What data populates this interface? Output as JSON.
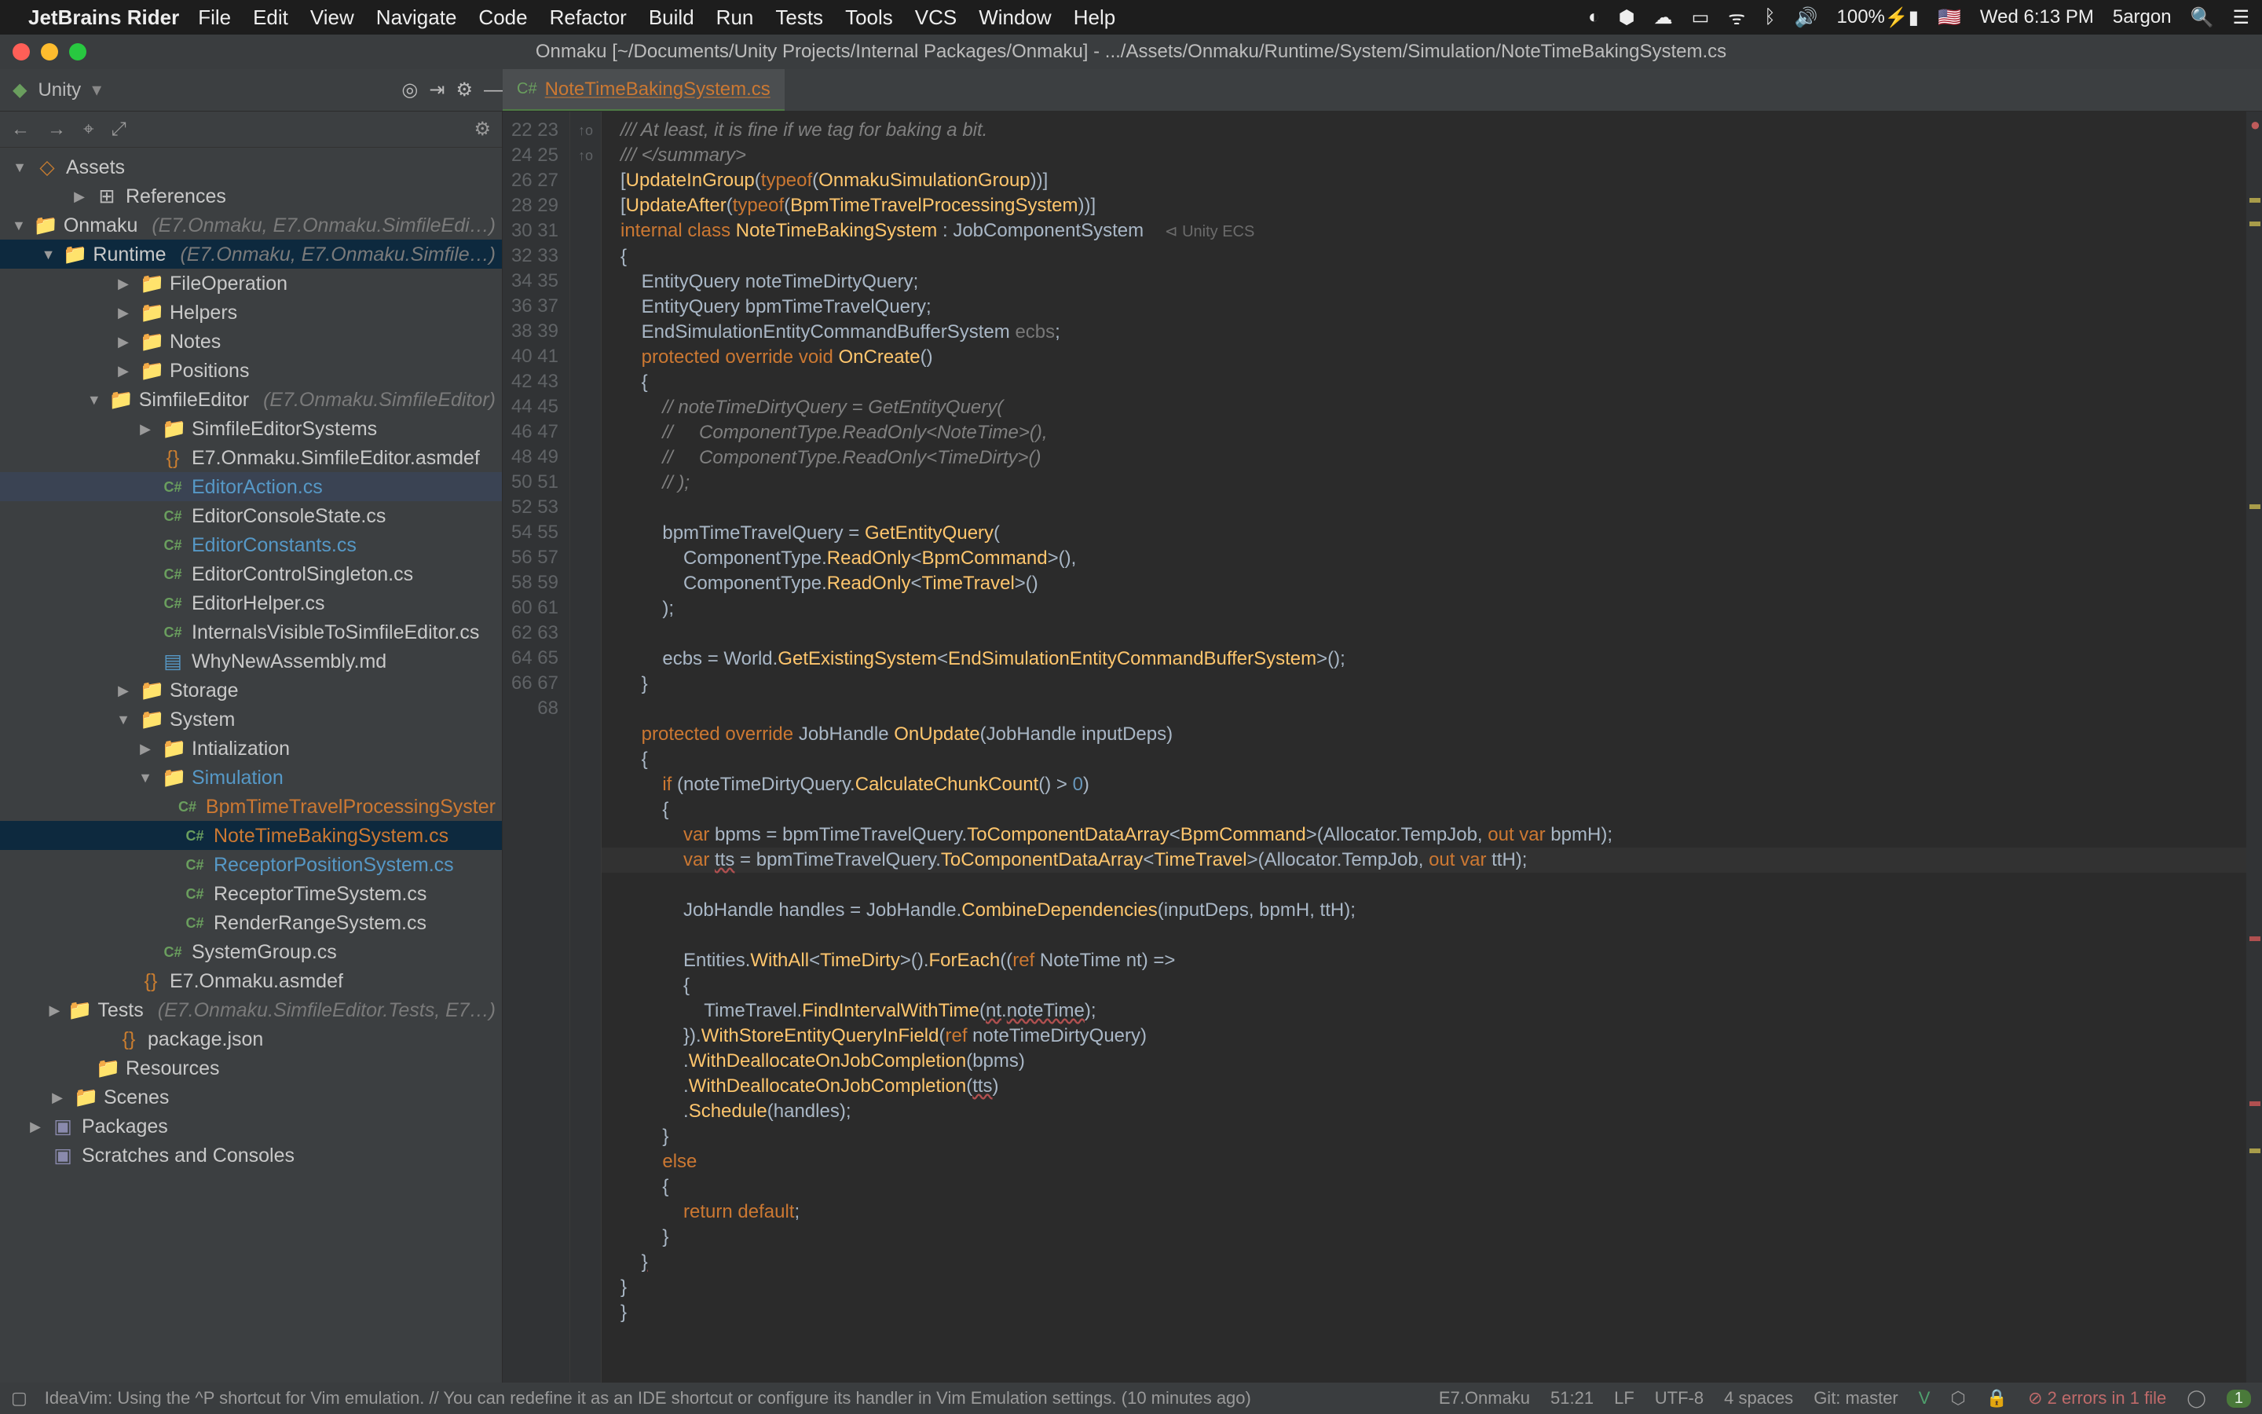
{
  "menubar": {
    "app": "JetBrains Rider",
    "items": [
      "File",
      "Edit",
      "View",
      "Navigate",
      "Code",
      "Refactor",
      "Build",
      "Run",
      "Tests",
      "Tools",
      "VCS",
      "Window",
      "Help"
    ],
    "tray": {
      "battery": "100%",
      "clock": "Wed 6:13 PM",
      "user": "5argon"
    }
  },
  "titlebar": {
    "title": "Onmaku [~/Documents/Unity Projects/Internal Packages/Onmaku] - .../Assets/Onmaku/Runtime/System/Simulation/NoteTimeBakingSystem.cs"
  },
  "topbar": {
    "crumb": "Unity",
    "tab": {
      "tag": "C#",
      "name": "NoteTimeBakingSystem.cs"
    }
  },
  "project_root_label": "Assets",
  "tree": [
    {
      "d": 0,
      "tw": "▶",
      "ic": "ref",
      "t": "References"
    },
    {
      "d": 0,
      "tw": "▼",
      "ic": "folder",
      "t": "Onmaku",
      "dim": "(E7.Onmaku, E7.Onmaku.SimfileEdi…)"
    },
    {
      "d": 1,
      "tw": "▼",
      "ic": "folder",
      "t": "Runtime",
      "dim": "(E7.Onmaku, E7.Onmaku.Simfile…)",
      "hi": true
    },
    {
      "d": 2,
      "tw": "▶",
      "ic": "folder",
      "t": "FileOperation"
    },
    {
      "d": 2,
      "tw": "▶",
      "ic": "folder",
      "t": "Helpers"
    },
    {
      "d": 2,
      "tw": "▶",
      "ic": "folder",
      "t": "Notes"
    },
    {
      "d": 2,
      "tw": "▶",
      "ic": "folder",
      "t": "Positions"
    },
    {
      "d": 2,
      "tw": "▼",
      "ic": "folder",
      "t": "SimfileEditor",
      "dim": "(E7.Onmaku.SimfileEditor)"
    },
    {
      "d": 3,
      "tw": "▶",
      "ic": "folder",
      "t": "SimfileEditorSystems"
    },
    {
      "d": 3,
      "tw": "",
      "ic": "asm",
      "t": "E7.Onmaku.SimfileEditor.asmdef"
    },
    {
      "d": 3,
      "tw": "",
      "ic": "cs",
      "t": "EditorAction.cs",
      "cls": "blue",
      "sel": true
    },
    {
      "d": 3,
      "tw": "",
      "ic": "cs",
      "t": "EditorConsoleState.cs"
    },
    {
      "d": 3,
      "tw": "",
      "ic": "cs",
      "t": "EditorConstants.cs",
      "cls": "blue"
    },
    {
      "d": 3,
      "tw": "",
      "ic": "cs",
      "t": "EditorControlSingleton.cs"
    },
    {
      "d": 3,
      "tw": "",
      "ic": "cs",
      "t": "EditorHelper.cs"
    },
    {
      "d": 3,
      "tw": "",
      "ic": "cs",
      "t": "InternalsVisibleToSimfileEditor.cs"
    },
    {
      "d": 3,
      "tw": "",
      "ic": "md",
      "t": "WhyNewAssembly.md"
    },
    {
      "d": 2,
      "tw": "▶",
      "ic": "folder",
      "t": "Storage"
    },
    {
      "d": 2,
      "tw": "▼",
      "ic": "folder",
      "t": "System"
    },
    {
      "d": 3,
      "tw": "▶",
      "ic": "folder",
      "t": "Intialization"
    },
    {
      "d": 3,
      "tw": "▼",
      "ic": "folder",
      "t": "Simulation",
      "cls": "blue"
    },
    {
      "d": 4,
      "tw": "",
      "ic": "cs",
      "t": "BpmTimeTravelProcessingSyster",
      "cls": "orange"
    },
    {
      "d": 4,
      "tw": "",
      "ic": "cs",
      "t": "NoteTimeBakingSystem.cs",
      "cls": "orange",
      "hi": true
    },
    {
      "d": 4,
      "tw": "",
      "ic": "cs",
      "t": "ReceptorPositionSystem.cs",
      "cls": "blue"
    },
    {
      "d": 4,
      "tw": "",
      "ic": "cs",
      "t": "ReceptorTimeSystem.cs"
    },
    {
      "d": 4,
      "tw": "",
      "ic": "cs",
      "t": "RenderRangeSystem.cs"
    },
    {
      "d": 3,
      "tw": "",
      "ic": "cs",
      "t": "SystemGroup.cs"
    },
    {
      "d": 2,
      "tw": "",
      "ic": "asm",
      "t": "E7.Onmaku.asmdef"
    },
    {
      "d": 1,
      "tw": "▶",
      "ic": "folder",
      "t": "Tests",
      "dim": "(E7.Onmaku.SimfileEditor.Tests, E7…)"
    },
    {
      "d": 1,
      "tw": "",
      "ic": "json",
      "t": "package.json"
    },
    {
      "d": 0,
      "tw": "",
      "ic": "folder",
      "t": "Resources"
    },
    {
      "d": -1,
      "tw": "▶",
      "ic": "folder",
      "t": "Scenes"
    },
    {
      "d": -2,
      "tw": "▶",
      "ic": "pkg",
      "t": "Packages"
    },
    {
      "d": -2,
      "tw": "",
      "ic": "pkg",
      "t": "Scratches and Consoles"
    }
  ],
  "gutter_start": 22,
  "gutter_end": 68,
  "code_hint_line26": "⊲ Unity ECS",
  "status": {
    "msg": "IdeaVim: Using the ^P shortcut for Vim emulation. // You can redefine it as an IDE shortcut or configure its handler in Vim Emulation settings. (10 minutes ago)",
    "ns": "E7.Onmaku",
    "pos": "51:21",
    "eol": "LF",
    "enc": "UTF-8",
    "indent": "4 spaces",
    "git": "Git: master",
    "errors": "2 errors in 1 file",
    "badge": "1"
  }
}
